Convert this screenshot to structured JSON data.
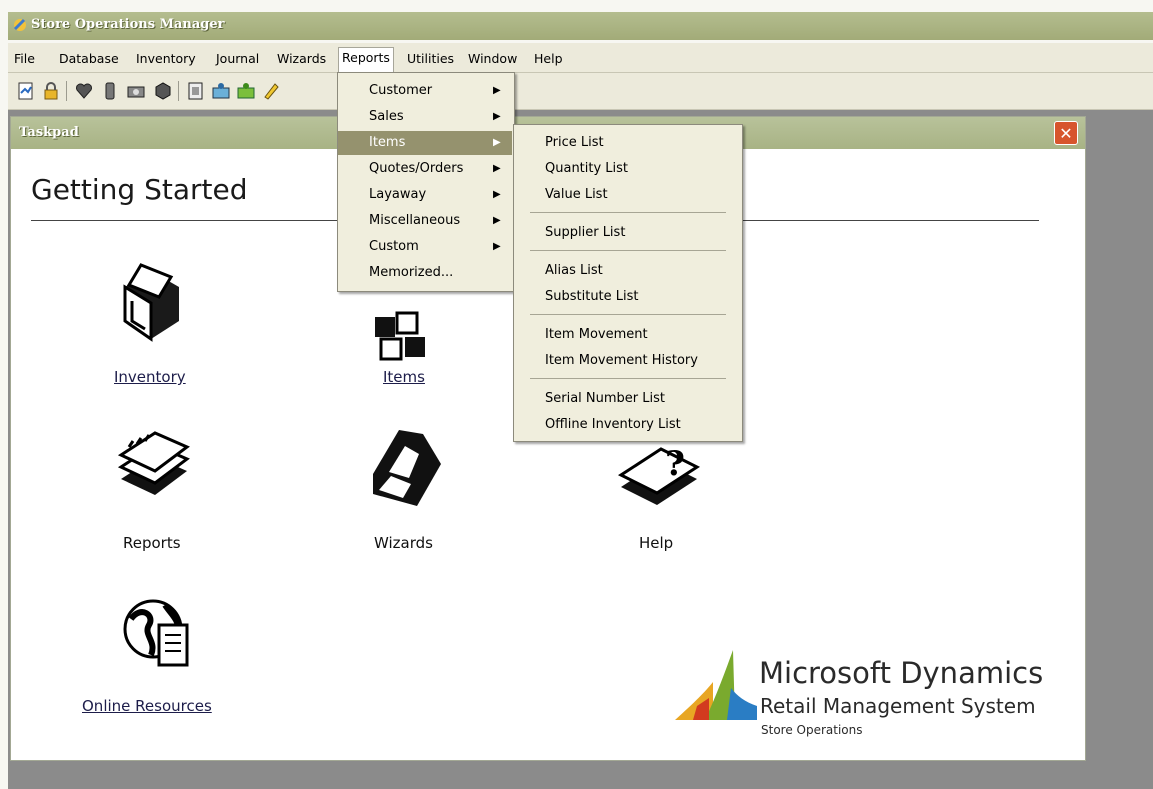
{
  "app": {
    "title": "Store Operations Manager"
  },
  "menubar": {
    "items": [
      {
        "label": "File"
      },
      {
        "label": "Database"
      },
      {
        "label": "Inventory"
      },
      {
        "label": "Journal"
      },
      {
        "label": "Wizards"
      },
      {
        "label": "Reports"
      },
      {
        "label": "Utilities"
      },
      {
        "label": "Window"
      },
      {
        "label": "Help"
      }
    ]
  },
  "toolbar": {
    "icons": [
      "report-icon",
      "lock-icon",
      "heart-icon",
      "database-icon",
      "journal-icon",
      "inventory-box-icon",
      "document-icon",
      "folder-user-icon",
      "folder-green-icon",
      "pencil-icon"
    ]
  },
  "reports_menu": {
    "items": [
      {
        "label": "Customer",
        "submenu": true
      },
      {
        "label": "Sales",
        "submenu": true
      },
      {
        "label": "Items",
        "submenu": true,
        "highlighted": true
      },
      {
        "label": "Quotes/Orders",
        "submenu": true
      },
      {
        "label": "Layaway",
        "submenu": true
      },
      {
        "label": "Miscellaneous",
        "submenu": true
      },
      {
        "label": "Custom",
        "submenu": true
      },
      {
        "label": "Memorized...",
        "submenu": false
      }
    ]
  },
  "items_submenu": {
    "groups": [
      [
        "Price List",
        "Quantity List",
        "Value List"
      ],
      [
        "Supplier List"
      ],
      [
        "Alias List",
        "Substitute List"
      ],
      [
        "Item Movement",
        "Item Movement History"
      ],
      [
        "Serial Number List",
        "Offline Inventory List"
      ]
    ]
  },
  "taskpad": {
    "title": "Taskpad",
    "heading": "Getting Started",
    "icons": [
      {
        "label": "Inventory",
        "icon": "inventory-box-icon",
        "link": true
      },
      {
        "label": "Items",
        "icon": "items-cubes-icon",
        "link": true
      },
      {
        "label": "Reports",
        "icon": "reports-books-icon",
        "link": false
      },
      {
        "label": "Wizards",
        "icon": "wizards-steps-icon",
        "link": false
      },
      {
        "label": "Help",
        "icon": "help-question-icon",
        "link": false
      },
      {
        "label": "Online Resources",
        "icon": "globe-document-icon",
        "link": true
      }
    ]
  },
  "branding": {
    "line1": "Microsoft Dynamics",
    "line2": "Retail Management System",
    "line3": "Store Operations",
    "colors": [
      "#e8a623",
      "#7aaa2e",
      "#2a7dc4",
      "#d23a1f"
    ]
  },
  "colors": {
    "titlebar": "#a8b07c",
    "menu_highlight": "#95926e",
    "close_button": "#d7552d"
  }
}
